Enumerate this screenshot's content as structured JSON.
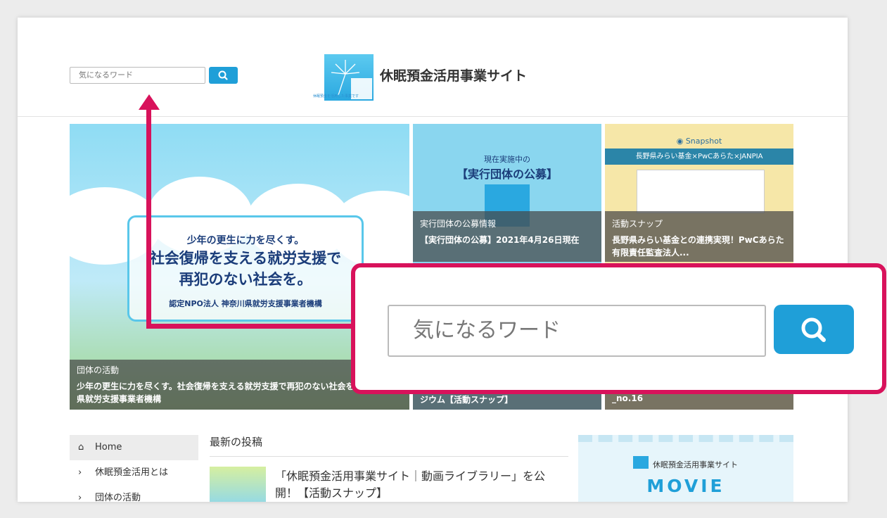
{
  "header": {
    "search_placeholder": "気になるワード",
    "site_title": "休眠預金活用事業サイト",
    "logo_sub": "休眠預金を活用した事業です"
  },
  "tiles": {
    "main": {
      "poster_l1": "少年の更生に力を尽くす。",
      "poster_l2": "社会復帰を支える就労支援で",
      "poster_l3": "再犯のない社会を。",
      "poster_org": "認定NPO法人 神奈川県就労支援事業者機構",
      "category": "団体の活動",
      "title": "少年の更生に力を尽くす。社会復帰を支える就労支援で再犯のない社会を。｜神奈川県就労支援事業者機構"
    },
    "second": {
      "small": "現在実施中の",
      "big": "【実行団体の公募】",
      "category": "実行団体の公募情報",
      "title": "【実行団体の公募】2021年4月26日現在",
      "bottom": "ジウム【活動スナップ】"
    },
    "third": {
      "snapshot": "Snapshot",
      "band": "長野県みらい基金×PwCあらた×JANPIA",
      "category": "活動スナップ",
      "title": "長野県みらい基金との連携実現！PwCあらた有限責任監査法人...",
      "bottom": "_no.16"
    }
  },
  "sidebar": {
    "items": [
      {
        "label": "Home",
        "icon": "home-icon"
      },
      {
        "label": "休眠預金活用とは",
        "icon": "chevron-right-icon"
      },
      {
        "label": "団体の活動",
        "icon": "chevron-right-icon"
      }
    ]
  },
  "latest": {
    "heading": "最新の投稿",
    "post_title": "「休眠預金活用事業サイト｜動画ライブラリー」を公開！【活動スナップ】"
  },
  "movie_banner": {
    "site": "休眠預金活用事業サイト",
    "word": "MOVIE"
  },
  "callout": {
    "placeholder": "気になるワード"
  },
  "colors": {
    "accent": "#1f9fd8",
    "annotation": "#d8125b"
  }
}
